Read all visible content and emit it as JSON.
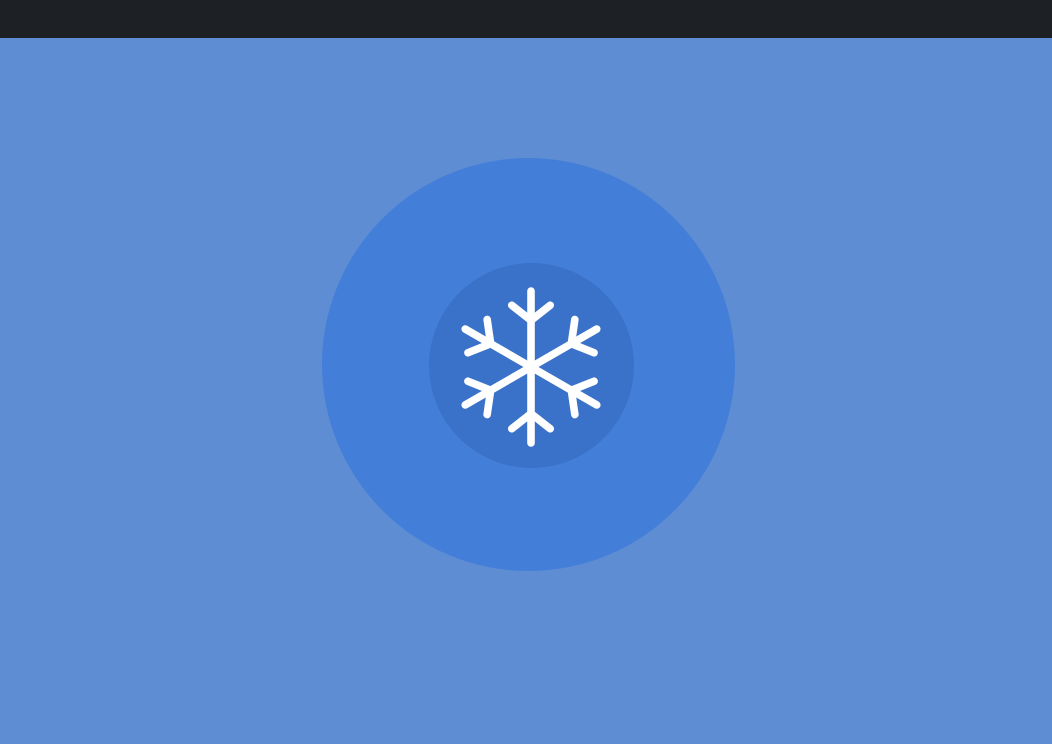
{
  "colors": {
    "top_bar": "#1d2125",
    "background": "#5f8dd3",
    "outer_circle": "#437fd8",
    "inner_circle": "#3a72c9",
    "icon": "#ffffff"
  },
  "icon": {
    "name": "snowflake-icon"
  }
}
